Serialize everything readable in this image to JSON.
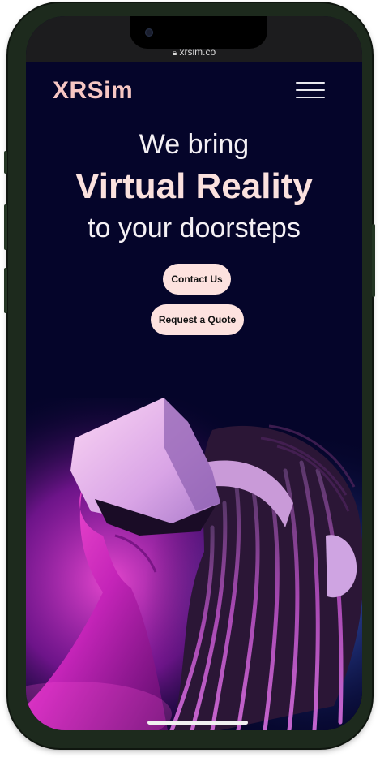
{
  "browser": {
    "url": "xrsim.co"
  },
  "header": {
    "logo": "XRSim",
    "menu_icon": "hamburger-menu-icon"
  },
  "hero": {
    "line1": "We bring",
    "line2": "Virtual Reality",
    "line3": "to your doorsteps",
    "primary_button": "Contact Us",
    "secondary_button": "Request a Quote",
    "image_alt": "Person wearing a VR headset looking upward"
  },
  "colors": {
    "background": "#05052a",
    "accent": "#f7c7c3",
    "button_bg": "#fde2df",
    "glow_pink": "#e23ad6",
    "glow_blue": "#3a6bff"
  }
}
